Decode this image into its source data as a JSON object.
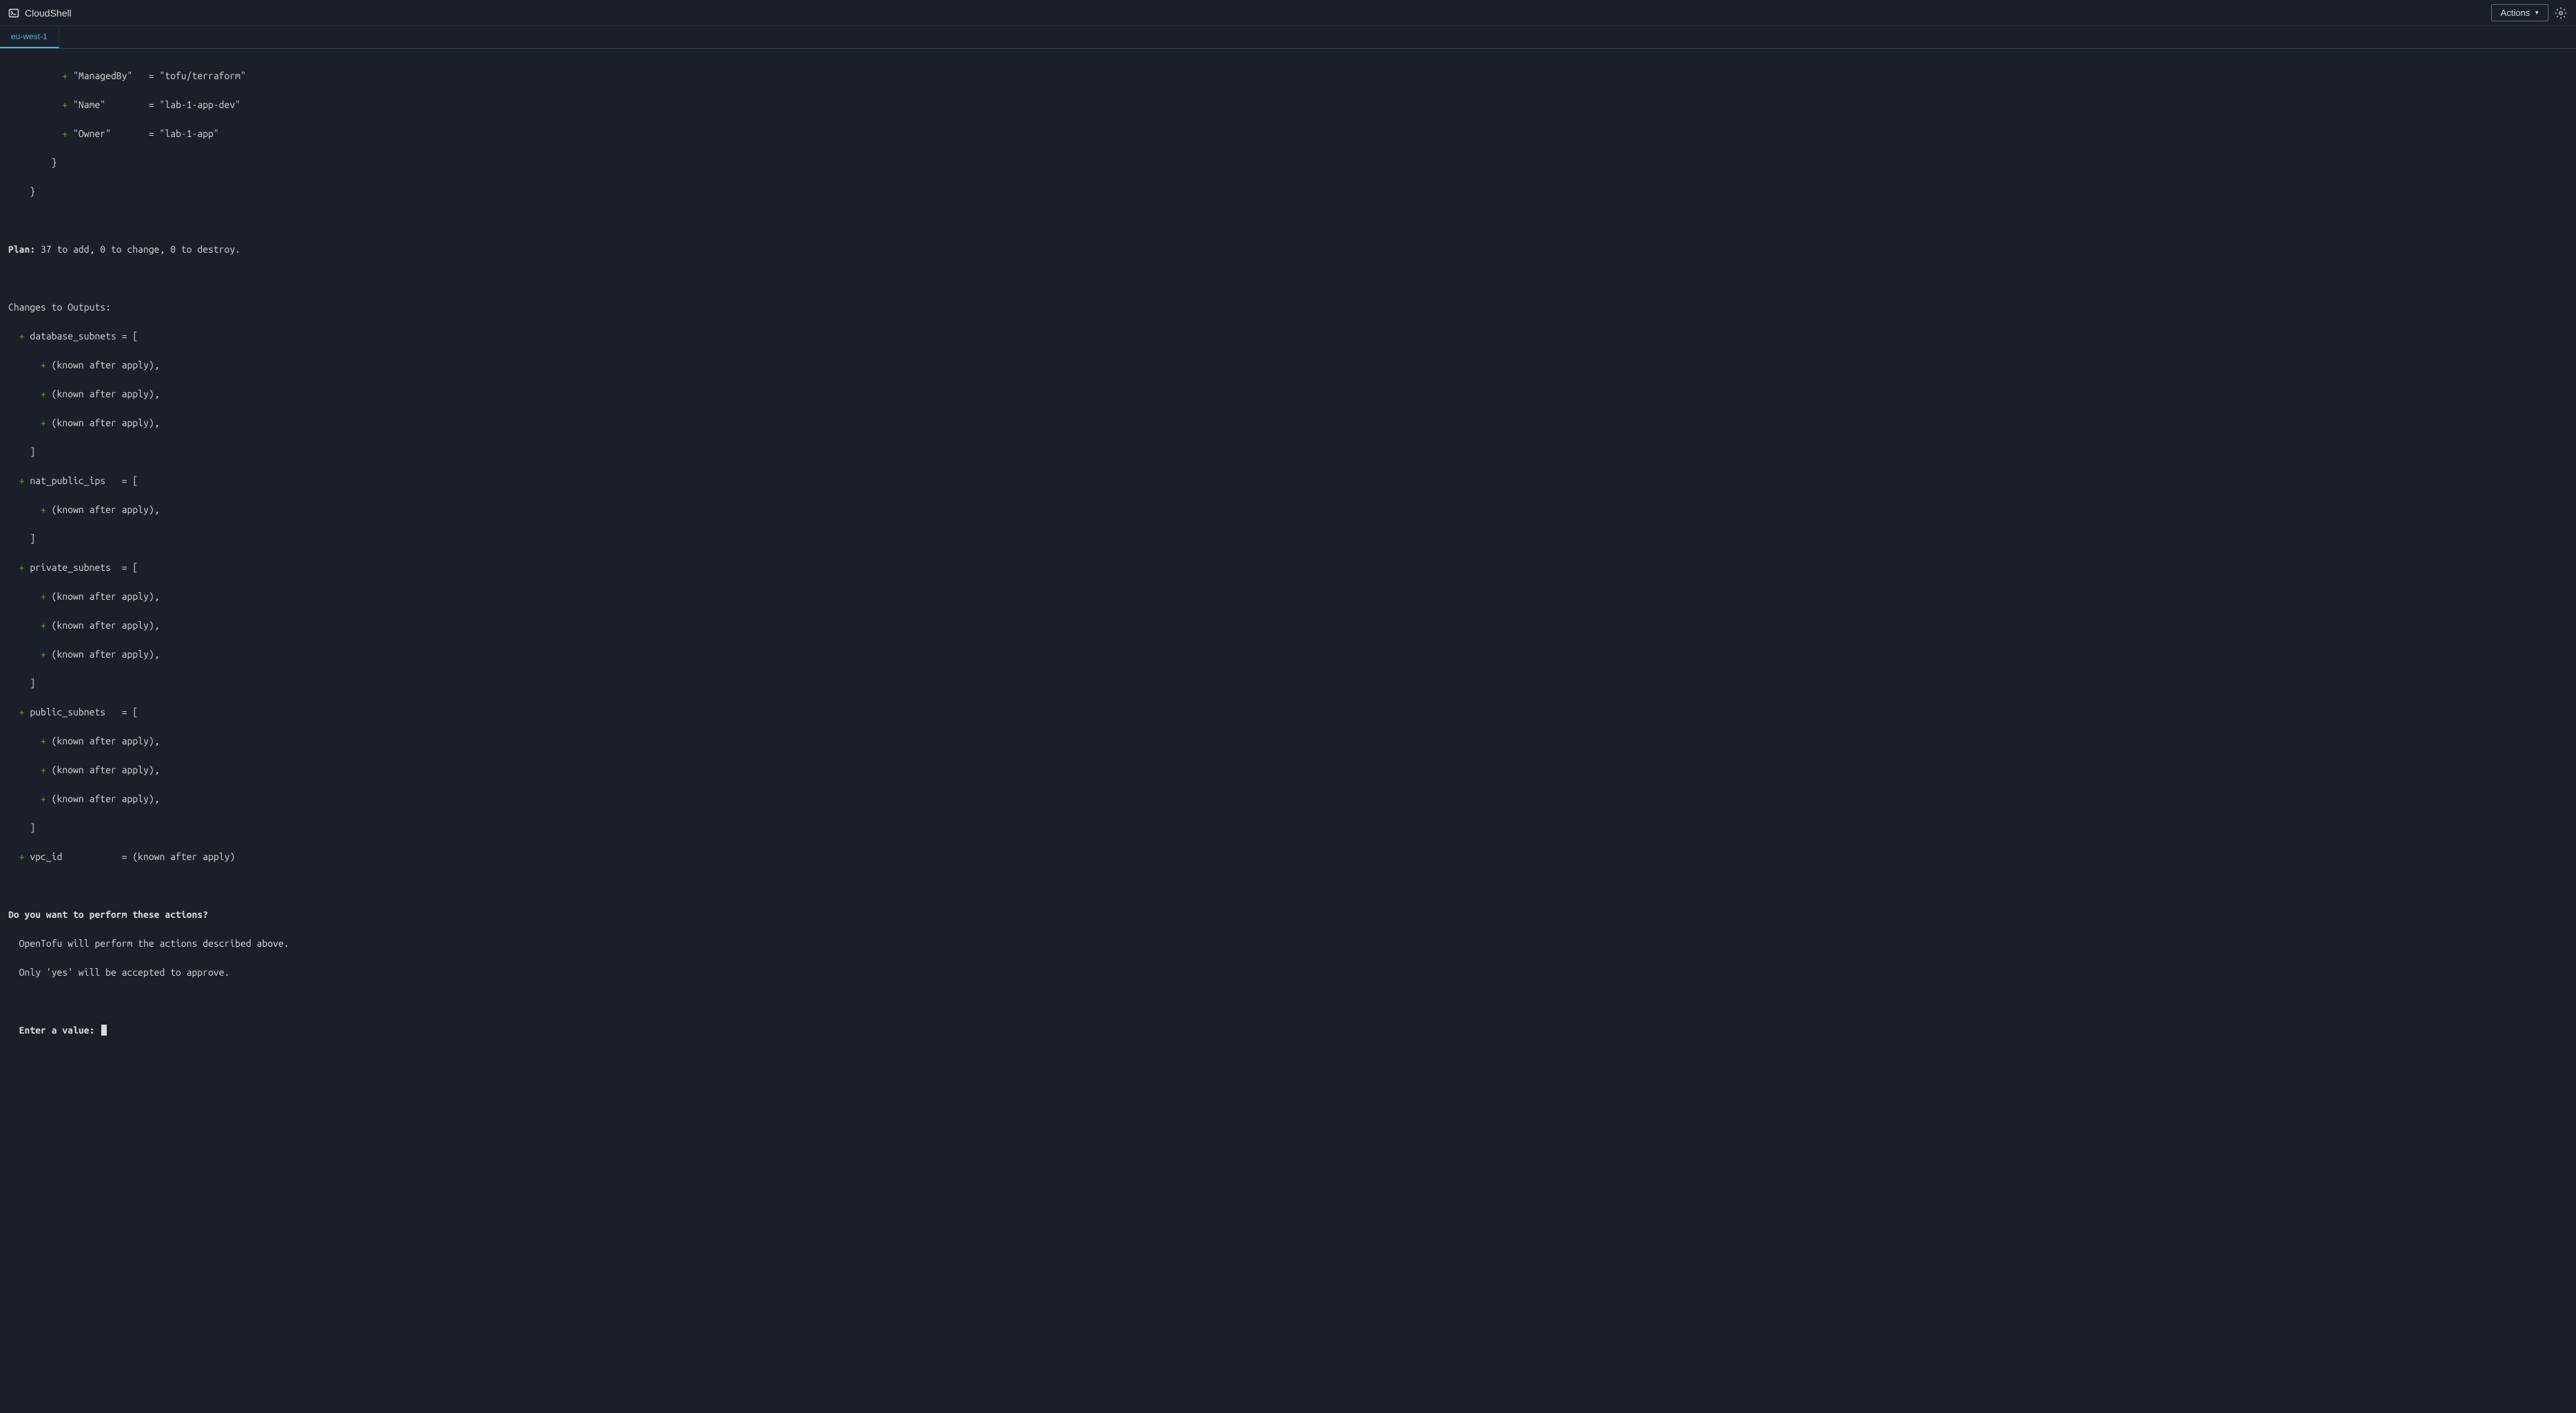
{
  "header": {
    "title": "CloudShell",
    "actions_label": "Actions"
  },
  "tabs": {
    "active": "eu-west-1"
  },
  "terminal": {
    "tags": {
      "managed_by_key": "\"ManagedBy\"",
      "managed_by_value": "\"tofu/terraform\"",
      "name_key": "\"Name\"",
      "name_value": "\"lab-1-app-dev\"",
      "owner_key": "\"Owner\"",
      "owner_value": "\"lab-1-app\""
    },
    "close_brace_1": "        }",
    "close_brace_2": "    }",
    "plan_label": "Plan:",
    "plan_text": " 37 to add, 0 to change, 0 to destroy.",
    "changes_header": "Changes to Outputs:",
    "outputs": {
      "database_subnets": {
        "name": "database_subnets",
        "eq": " = [",
        "items_count": 3
      },
      "nat_public_ips": {
        "name": "nat_public_ips",
        "eq": "   = [",
        "items_count": 1
      },
      "private_subnets": {
        "name": "private_subnets",
        "eq": "  = [",
        "items_count": 3
      },
      "public_subnets": {
        "name": "public_subnets",
        "eq": "   = [",
        "items_count": 3
      },
      "vpc_id": {
        "name": "vpc_id",
        "eq": "           = (known after apply)"
      }
    },
    "known_after_apply": "(known after apply),",
    "close_bracket": "    ]",
    "confirm_question": "Do you want to perform these actions?",
    "confirm_line1": "  OpenTofu will perform the actions described above.",
    "confirm_line2": "  Only 'yes' will be accepted to approve.",
    "enter_prompt": "  Enter a value: "
  }
}
